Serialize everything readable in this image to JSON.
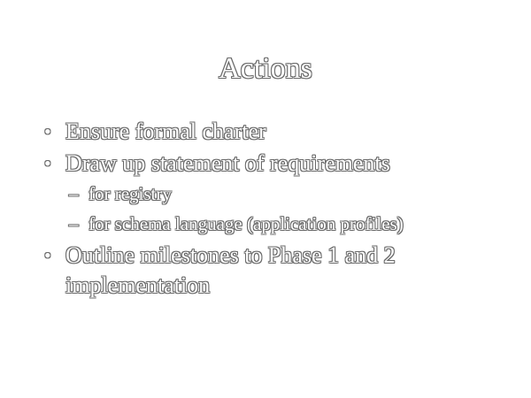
{
  "slide": {
    "title": "Actions",
    "bullets": [
      {
        "text": "Ensure formal charter"
      },
      {
        "text": "Draw up statement of requirements",
        "subitems": [
          "for registry",
          "for schema language (application profiles)"
        ]
      },
      {
        "text": "Outline milestones to Phase 1 and 2 implementation"
      }
    ],
    "bullet_glyph": "•",
    "sub_glyph": "–"
  }
}
